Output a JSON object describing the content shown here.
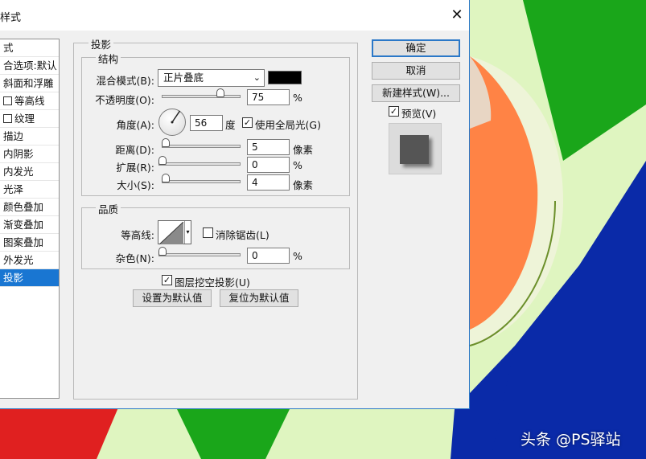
{
  "window": {
    "title": "样式",
    "close": "✕"
  },
  "style_list": {
    "items": [
      {
        "label": "式",
        "checkbox": false,
        "selected": false
      },
      {
        "label": "合选项:默认",
        "checkbox": false,
        "selected": false
      },
      {
        "label": "斜面和浮雕",
        "checkbox": false,
        "selected": false
      },
      {
        "label": "等高线",
        "checkbox": true,
        "selected": false
      },
      {
        "label": "纹理",
        "checkbox": true,
        "selected": false
      },
      {
        "label": "描边",
        "checkbox": false,
        "selected": false
      },
      {
        "label": "内阴影",
        "checkbox": false,
        "selected": false
      },
      {
        "label": "内发光",
        "checkbox": false,
        "selected": false
      },
      {
        "label": "光泽",
        "checkbox": false,
        "selected": false
      },
      {
        "label": "颜色叠加",
        "checkbox": false,
        "selected": false
      },
      {
        "label": "渐变叠加",
        "checkbox": false,
        "selected": false
      },
      {
        "label": "图案叠加",
        "checkbox": false,
        "selected": false
      },
      {
        "label": "外发光",
        "checkbox": false,
        "selected": false
      },
      {
        "label": "投影",
        "checkbox": false,
        "selected": true
      }
    ]
  },
  "panel": {
    "title": "投影",
    "structure": {
      "title": "结构",
      "blend_mode_label": "混合模式(B):",
      "blend_mode_value": "正片叠底",
      "blend_color": "#000000",
      "opacity_label": "不透明度(O):",
      "opacity_value": "75",
      "opacity_unit": "%",
      "opacity_level": 0.75,
      "angle_label": "角度(A):",
      "angle_value": "56",
      "angle_unit": "度",
      "global_light_label": "使用全局光(G)",
      "global_light_checked": true,
      "distance_label": "距离(D):",
      "distance_value": "5",
      "distance_unit": "像素",
      "spread_label": "扩展(R):",
      "spread_value": "0",
      "spread_unit": "%",
      "size_label": "大小(S):",
      "size_value": "4",
      "size_unit": "像素"
    },
    "quality": {
      "title": "品质",
      "contour_label": "等高线:",
      "antialias_label": "消除锯齿(L)",
      "antialias_checked": false,
      "noise_label": "杂色(N):",
      "noise_value": "0",
      "noise_unit": "%"
    },
    "knockout_label": "图层挖空投影(U)",
    "knockout_checked": true,
    "make_default": "设置为默认值",
    "reset_default": "复位为默认值"
  },
  "buttons": {
    "ok": "确定",
    "cancel": "取消",
    "new_style": "新建样式(W)...",
    "preview_label": "预览(V)",
    "preview_checked": true
  },
  "check_mark": "✓",
  "watermark": "头条 @PS驿站",
  "colors": {
    "accent": "#1976d2",
    "orange": "#ff8345"
  }
}
